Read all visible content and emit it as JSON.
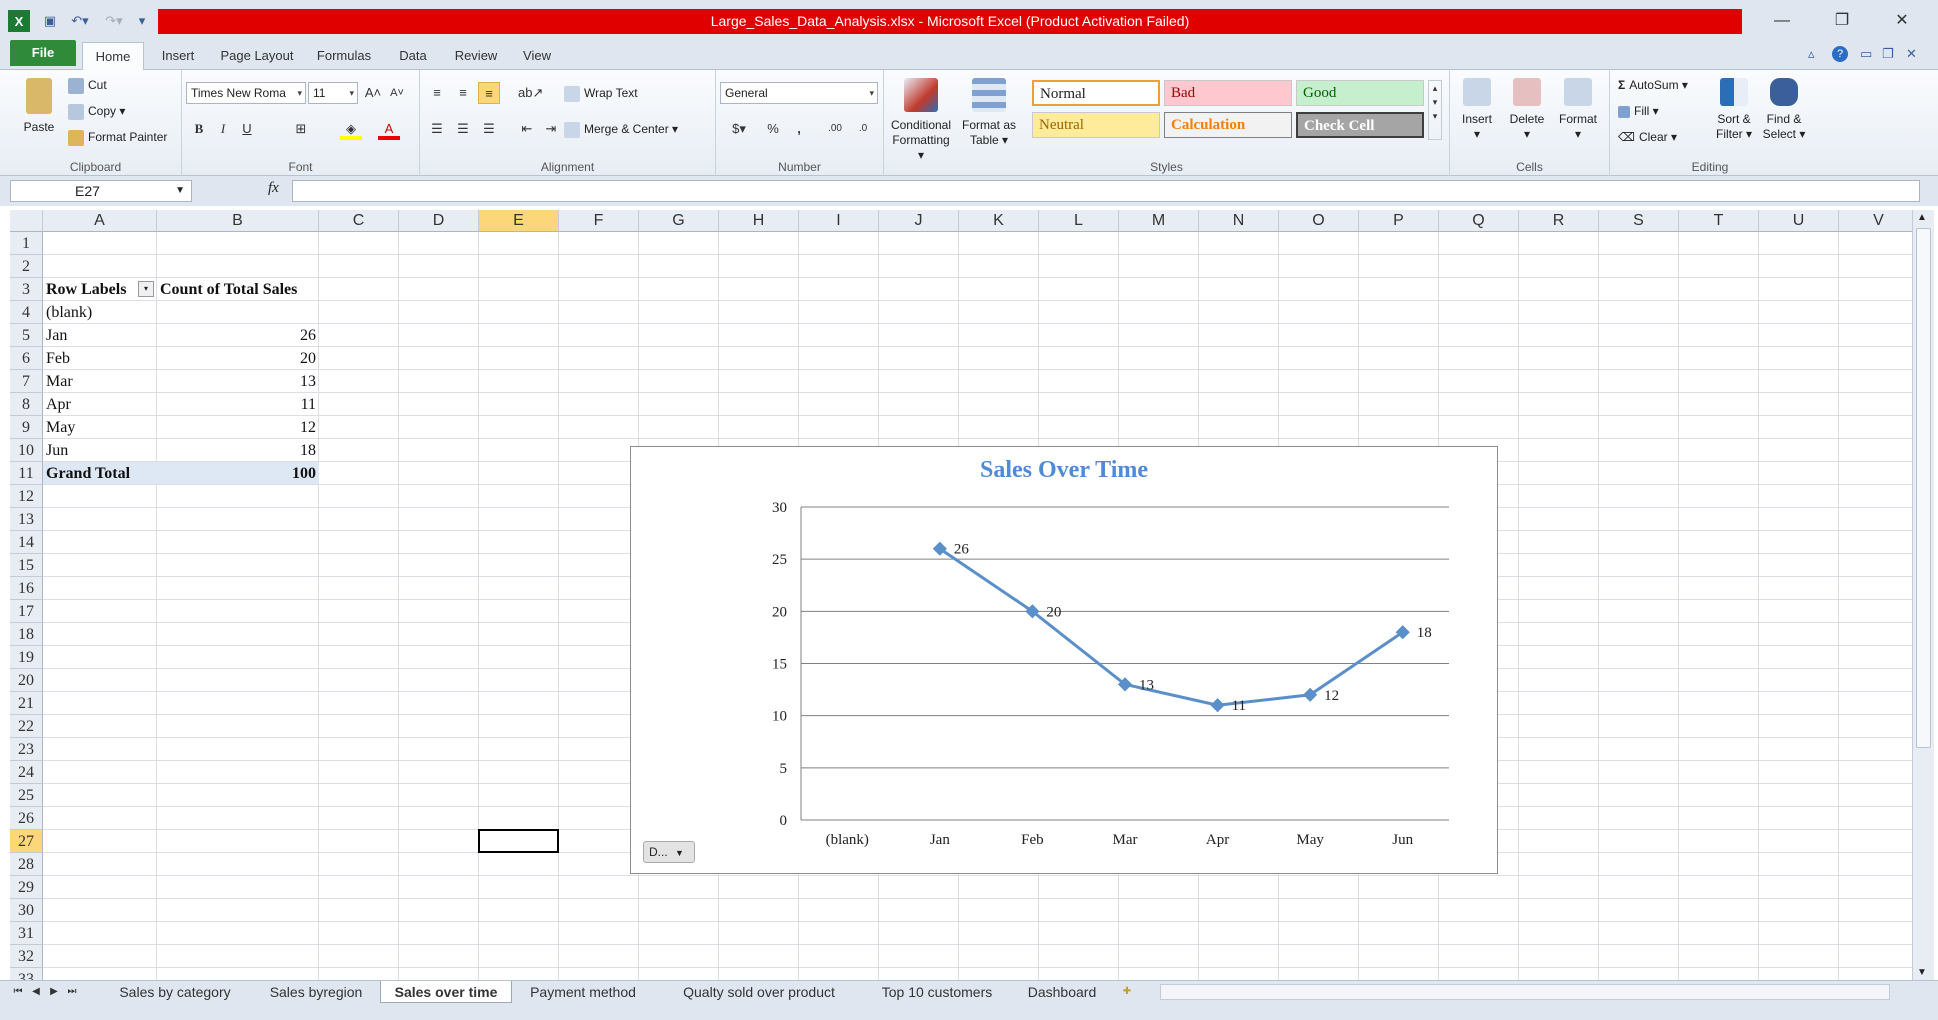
{
  "window": {
    "title": "Large_Sales_Data_Analysis.xlsx  -  Microsoft Excel (Product Activation Failed)",
    "minimize": "—",
    "restore": "❐",
    "close": "✕"
  },
  "quick_access": {
    "app_icon": "X",
    "save_icon": "save-icon",
    "undo_icon": "undo-icon",
    "redo_icon": "redo-icon"
  },
  "ribbon_tabs": [
    "File",
    "Home",
    "Insert",
    "Page Layout",
    "Formulas",
    "Data",
    "Review",
    "View"
  ],
  "active_tab": "Home",
  "clipboard": {
    "paste": "Paste",
    "cut": "Cut",
    "copy": "Copy",
    "format_painter": "Format Painter",
    "label": "Clipboard"
  },
  "font": {
    "name": "Times New Roma",
    "size": "11",
    "label": "Font",
    "bold": "B",
    "italic": "I",
    "underline": "U"
  },
  "alignment": {
    "wrap_text": "Wrap Text",
    "merge_center": "Merge & Center",
    "label": "Alignment"
  },
  "number": {
    "format": "General",
    "percent": "%",
    "comma": ",",
    "label": "Number"
  },
  "styles": {
    "conditional_formatting": [
      "Conditional",
      "Formatting"
    ],
    "format_as_table": [
      "Format as",
      "Table"
    ],
    "cells": [
      {
        "name": "Normal",
        "bg": "#ffffff",
        "color": "#000000",
        "border": "#f0a030"
      },
      {
        "name": "Bad",
        "bg": "#ffc7ce",
        "color": "#9c0006",
        "border": "#ffc7ce"
      },
      {
        "name": "Good",
        "bg": "#c6efce",
        "color": "#006100",
        "border": "#c6efce"
      },
      {
        "name": "Neutral",
        "bg": "#ffeb9c",
        "color": "#9c6500",
        "border": "#ffeb9c"
      },
      {
        "name": "Calculation",
        "bg": "#f2f2f2",
        "color": "#fa7d00",
        "border": "#7f7f7f"
      },
      {
        "name": "Check Cell",
        "bg": "#a5a5a5",
        "color": "#ffffff",
        "border": "#3f3f3f"
      }
    ],
    "label": "Styles"
  },
  "cells_group": {
    "insert": "Insert",
    "delete": "Delete",
    "format": "Format",
    "label": "Cells"
  },
  "editing": {
    "autosum": "AutoSum",
    "fill": "Fill",
    "clear": "Clear",
    "sort_filter": [
      "Sort &",
      "Filter"
    ],
    "find_select": [
      "Find &",
      "Select"
    ],
    "label": "Editing"
  },
  "formula_bar": {
    "name_box": "E27",
    "fx": "fx",
    "formula": ""
  },
  "columns": [
    "A",
    "B",
    "C",
    "D",
    "E",
    "F",
    "G",
    "H",
    "I",
    "J",
    "K",
    "L",
    "M",
    "N",
    "O",
    "P",
    "Q",
    "R",
    "S",
    "T",
    "U",
    "V"
  ],
  "selected_column": "E",
  "selected_row": "27",
  "rows": [
    "1",
    "2",
    "3",
    "4",
    "5",
    "6",
    "7",
    "8",
    "9",
    "10",
    "11",
    "12",
    "13",
    "14",
    "15",
    "16",
    "17",
    "18",
    "19",
    "20",
    "21",
    "22",
    "23",
    "24",
    "25",
    "26",
    "27",
    "28",
    "29",
    "30",
    "31",
    "32",
    "33"
  ],
  "pivot": {
    "header_labels": "Row Labels",
    "header_values": "Count of Total Sales",
    "rows": [
      {
        "label": "(blank)",
        "value": ""
      },
      {
        "label": "Jan",
        "value": "26"
      },
      {
        "label": "Feb",
        "value": "20"
      },
      {
        "label": "Mar",
        "value": "13"
      },
      {
        "label": "Apr",
        "value": "11"
      },
      {
        "label": "May",
        "value": "12"
      },
      {
        "label": "Jun",
        "value": "18"
      }
    ],
    "grand_total_label": "Grand Total",
    "grand_total_value": "100"
  },
  "chart_data": {
    "type": "line",
    "title": "Sales Over Time",
    "categories": [
      "(blank)",
      "Jan",
      "Feb",
      "Mar",
      "Apr",
      "May",
      "Jun"
    ],
    "series": [
      {
        "values": [
          null,
          26,
          20,
          13,
          11,
          12,
          18
        ],
        "color": "#5b8fc9"
      }
    ],
    "ylim": [
      0,
      30
    ],
    "yticks": [
      0,
      5,
      10,
      15,
      20,
      25,
      30
    ],
    "grid": true,
    "data_labels": true,
    "filter_button": "D..."
  },
  "sheet_tabs": [
    "Sales  by category",
    "Sales byregion",
    "Sales over time",
    "Payment method",
    "Qualty sold over product",
    "Top 10 customers",
    "Dashboard"
  ],
  "active_sheet": "Sales over time"
}
